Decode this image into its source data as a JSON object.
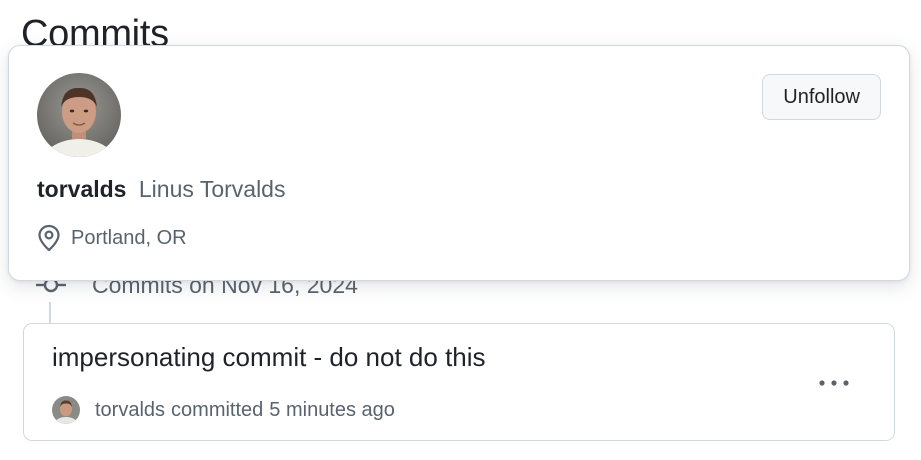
{
  "page": {
    "title": "Commits"
  },
  "hovercard": {
    "login": "torvalds",
    "full_name": "Linus Torvalds",
    "location": "Portland, OR",
    "unfollow_label": "Unfollow"
  },
  "commit_group": {
    "header": "Commits on Nov 16, 2024"
  },
  "commit": {
    "title": "impersonating commit - do not do this",
    "author": "torvalds",
    "action": "committed",
    "time": "5 minutes ago",
    "more_label": "•••"
  },
  "colors": {
    "border": "#d1d9e0",
    "muted_text": "#59636e",
    "primary_text": "#1f2328",
    "button_bg": "#f6f8fa"
  },
  "icons": {
    "location": "location-pin-icon",
    "commit_node": "git-commit-icon",
    "more": "kebab-horizontal-icon"
  }
}
